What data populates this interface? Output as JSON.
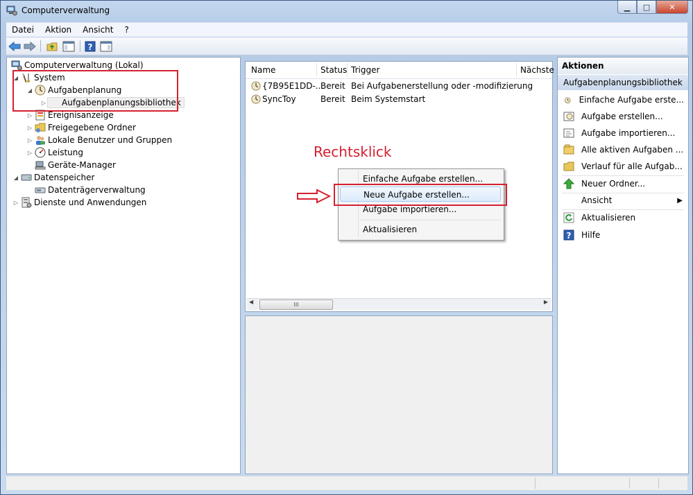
{
  "window": {
    "title": "Computerverwaltung"
  },
  "menu": [
    "Datei",
    "Aktion",
    "Ansicht",
    "?"
  ],
  "tree": {
    "root": "Computerverwaltung (Lokal)",
    "system": "System",
    "aufgabenplanung": "Aufgabenplanung",
    "bibliothek": "Aufgabenplanungsbibliothek",
    "ereignis": "Ereignisanzeige",
    "freigaben": "Freigegebene Ordner",
    "benutzer": "Lokale Benutzer und Gruppen",
    "leistung": "Leistung",
    "geraete": "Geräte-Manager",
    "datenspeicher": "Datenspeicher",
    "datentraeger": "Datenträgerverwaltung",
    "dienste": "Dienste und Anwendungen"
  },
  "list": {
    "columns": [
      "Name",
      "Status",
      "Trigger",
      "Nächste"
    ],
    "rows": [
      {
        "name": "{7B95E1DD-...",
        "status": "Bereit",
        "trigger": "Bei Aufgabenerstellung oder -modifizierung"
      },
      {
        "name": "SyncToy",
        "status": "Bereit",
        "trigger": "Beim Systemstart"
      }
    ],
    "scroll_grip": "III"
  },
  "context_menu": {
    "items": [
      "Einfache Aufgabe erstellen...",
      "Neue Aufgabe erstellen...",
      "Aufgabe importieren...",
      "Aktualisieren"
    ],
    "selected_index": 1
  },
  "annotation": {
    "label": "Rechtsklick",
    "color": "#d42030"
  },
  "actions": {
    "header": "Aktionen",
    "section": "Aufgabenplanungsbibliothek",
    "items": [
      "Einfache Aufgabe erste...",
      "Aufgabe erstellen...",
      "Aufgabe importieren...",
      "Alle aktiven Aufgaben ...",
      "Verlauf für alle Aufgab...",
      "Neuer Ordner...",
      "Ansicht",
      "Aktualisieren",
      "Hilfe"
    ]
  }
}
